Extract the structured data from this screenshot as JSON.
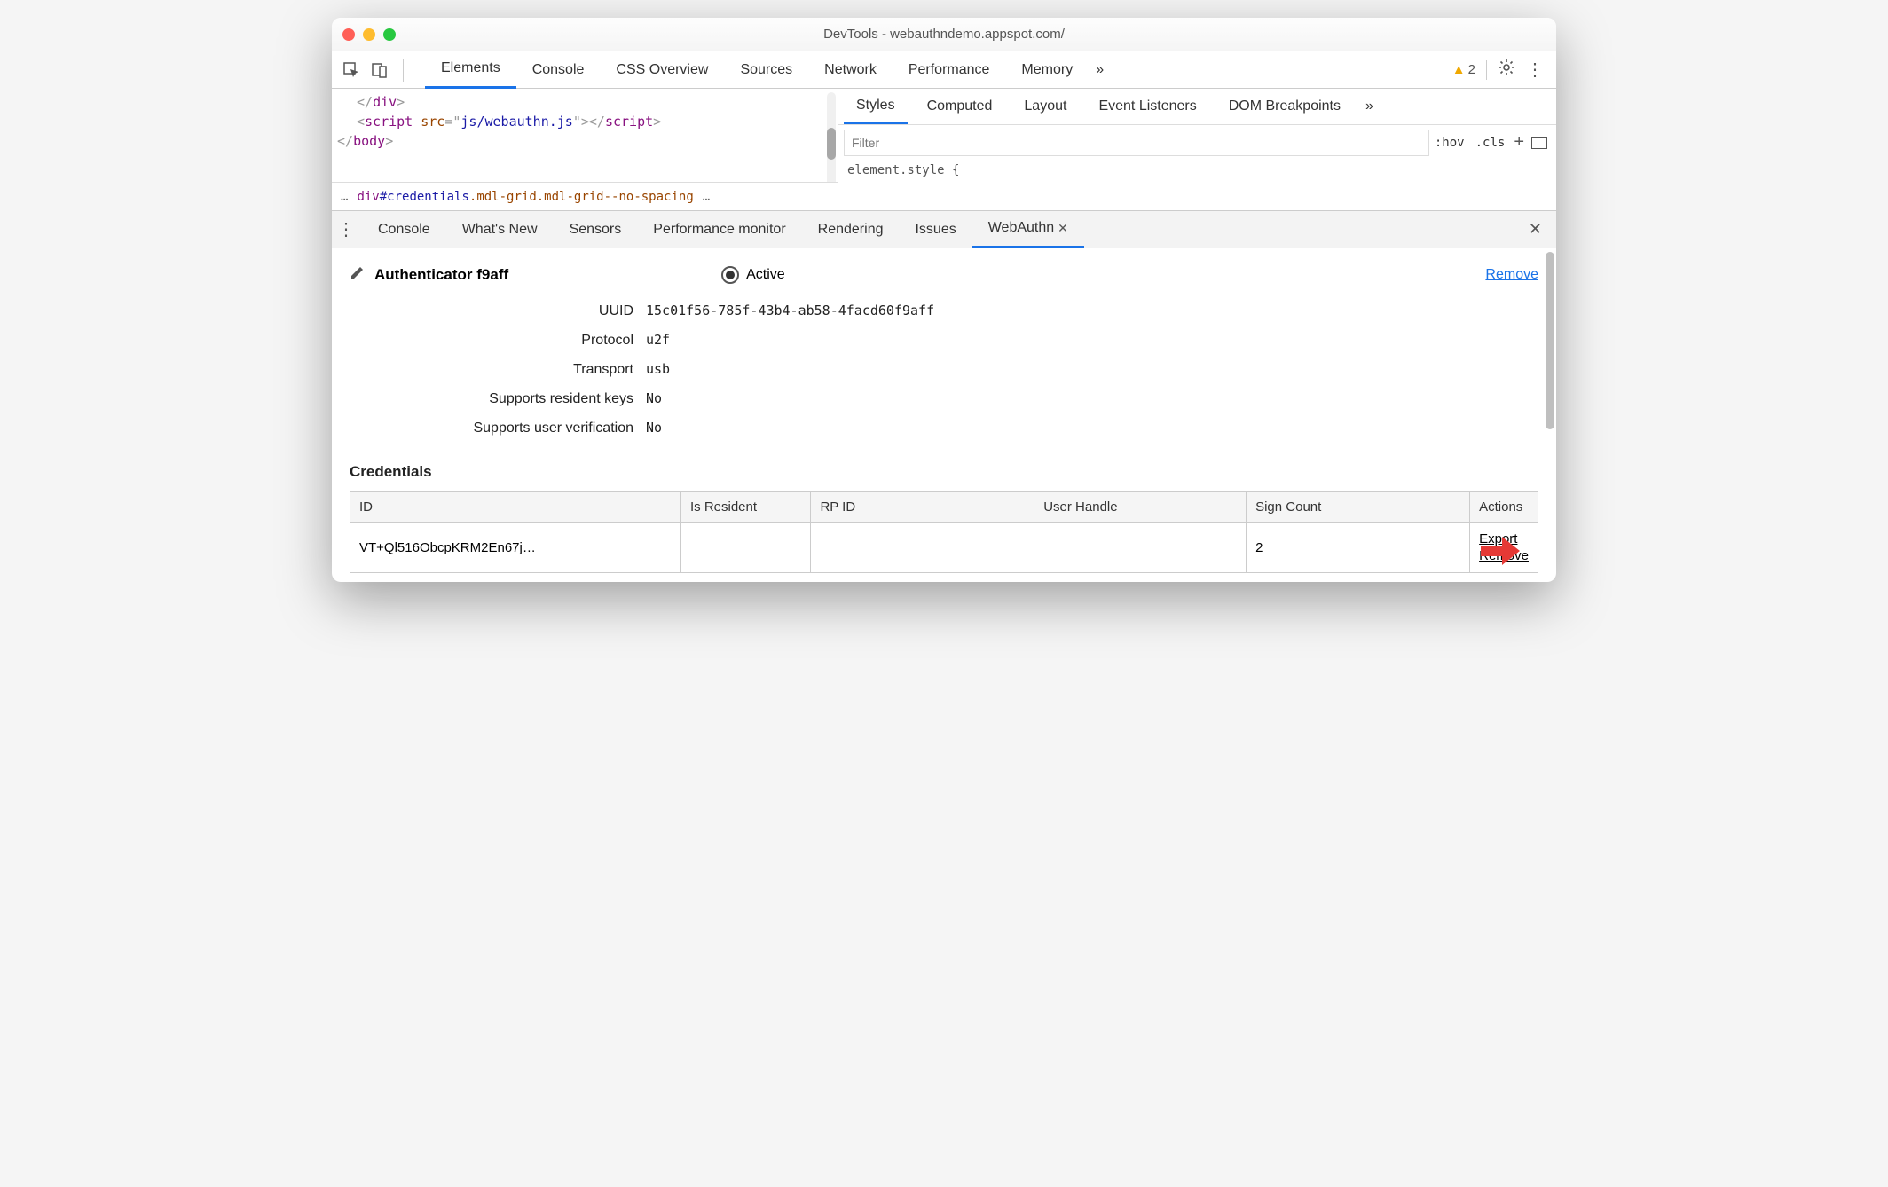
{
  "window_title": "DevTools - webauthndemo.appspot.com/",
  "main_tabs": [
    "Elements",
    "Console",
    "CSS Overview",
    "Sources",
    "Network",
    "Performance",
    "Memory"
  ],
  "main_tab_active": 0,
  "warning_count": "2",
  "code_snippet": {
    "line1_close": "</div>",
    "line2_tag": "script",
    "line2_attr": "src",
    "line2_val": "js/webauthn.js",
    "line3_close": "</body>"
  },
  "breadcrumb": {
    "left_dots": "…",
    "seg_tag": "div",
    "seg_id": "#credentials",
    "seg_cls": ".mdl-grid.mdl-grid--no-spacing",
    "right_dots": "…"
  },
  "styles_tabs": [
    "Styles",
    "Computed",
    "Layout",
    "Event Listeners",
    "DOM Breakpoints"
  ],
  "styles_tab_active": 0,
  "filter_placeholder": "Filter",
  "hov_label": ":hov",
  "cls_label": ".cls",
  "element_style_text": "element.style {",
  "drawer_tabs": [
    "Console",
    "What's New",
    "Sensors",
    "Performance monitor",
    "Rendering",
    "Issues",
    "WebAuthn"
  ],
  "drawer_tab_active": 6,
  "authenticator": {
    "title": "Authenticator f9aff",
    "active_label": "Active",
    "remove_label": "Remove",
    "props": [
      {
        "label": "UUID",
        "value": "15c01f56-785f-43b4-ab58-4facd60f9aff"
      },
      {
        "label": "Protocol",
        "value": "u2f"
      },
      {
        "label": "Transport",
        "value": "usb"
      },
      {
        "label": "Supports resident keys",
        "value": "No"
      },
      {
        "label": "Supports user verification",
        "value": "No"
      }
    ]
  },
  "credentials_heading": "Credentials",
  "cred_columns": [
    "ID",
    "Is Resident",
    "RP ID",
    "User Handle",
    "Sign Count",
    "Actions"
  ],
  "cred_row": {
    "id": "VT+Ql516ObcpKRM2En67j…",
    "is_resident": "",
    "rp_id": "",
    "user_handle": "",
    "sign_count": "2",
    "export": "Export",
    "remove": "Remove"
  }
}
